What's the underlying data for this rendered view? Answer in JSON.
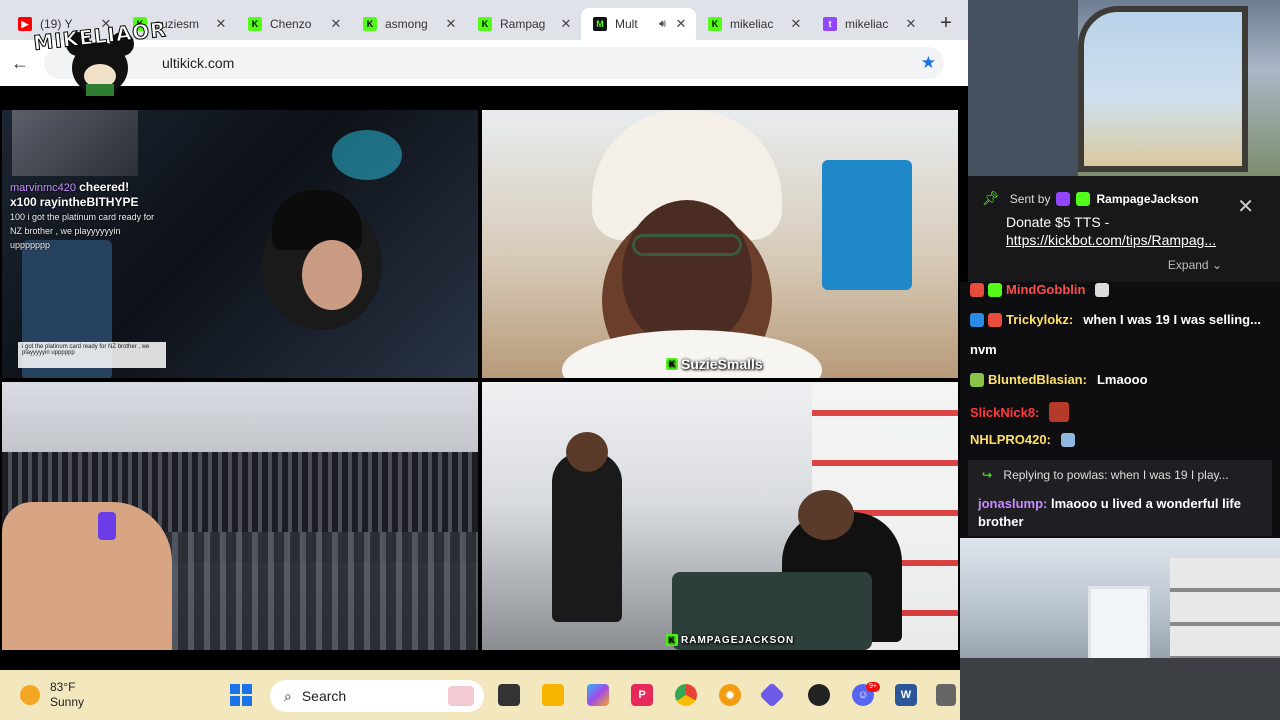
{
  "browser": {
    "tabs": [
      {
        "title": "(19) Y",
        "favicon": "youtube-icon"
      },
      {
        "title": "suziesm",
        "favicon": "kick-icon"
      },
      {
        "title": "Chenzo",
        "favicon": "kick-icon"
      },
      {
        "title": "asmong",
        "favicon": "kick-icon"
      },
      {
        "title": "Rampag",
        "favicon": "kick-icon"
      },
      {
        "title": "Mult",
        "favicon": "multikick-icon",
        "active": true
      },
      {
        "title": "mikeliac",
        "favicon": "kick-icon"
      },
      {
        "title": "mikeliac",
        "favicon": "twitch-icon"
      }
    ],
    "url": "ultikick.com",
    "logo_text": "MIKELIAOR"
  },
  "streams": {
    "top_left": {
      "alert_user": "marvinmc420",
      "alert_action": "cheered!",
      "alert_amount": "x100",
      "alert_name": "rayintheBITHYPE",
      "alert_message": "100 i got the platinum card ready for NZ brother , we playyyyyyin uppppppp",
      "mini_chat": "i got the platinum card ready for NZ brother , we playyyyyin upppppp"
    },
    "top_right": {
      "label": "SuzieSmalls"
    },
    "bottom_right": {
      "label": "RAMPAGEJACKSON"
    }
  },
  "pinned": {
    "sent_by_label": "Sent by",
    "sender": "RampageJackson",
    "message": "Donate $5 TTS -",
    "link": "https://kickbot.com/tips/Rampag...",
    "expand_label": "Expand"
  },
  "chat": {
    "messages": [
      {
        "user": "MindGobblin",
        "text": "",
        "color": "#ff4d4d"
      },
      {
        "user": "Trickylokz:",
        "text": "when I was 19 I was selling...",
        "color": "#ffe066"
      },
      {
        "user": "",
        "text": "nvm",
        "color": "#ffffff"
      },
      {
        "user": "BluntedBlasian:",
        "text": "Lmaooo",
        "color": "#ffe066"
      },
      {
        "user": "SlickNick8:",
        "text": "",
        "color": "#ff3b3b"
      },
      {
        "user": "NHLPRO420:",
        "text": "",
        "color": "#ffe066"
      }
    ],
    "reply": {
      "replying_to": "Replying to powlas: when I was 19 I play...",
      "user": "jonaslump:",
      "text": "lmaooo u lived a wonderful life brother"
    }
  },
  "taskbar": {
    "temperature": "83°F",
    "condition": "Sunny",
    "search_label": "Search"
  },
  "colors": {
    "kick_green": "#53fc18",
    "taskbar_bg": "#f2e7bd",
    "chat_bg": "#0e0e10"
  }
}
